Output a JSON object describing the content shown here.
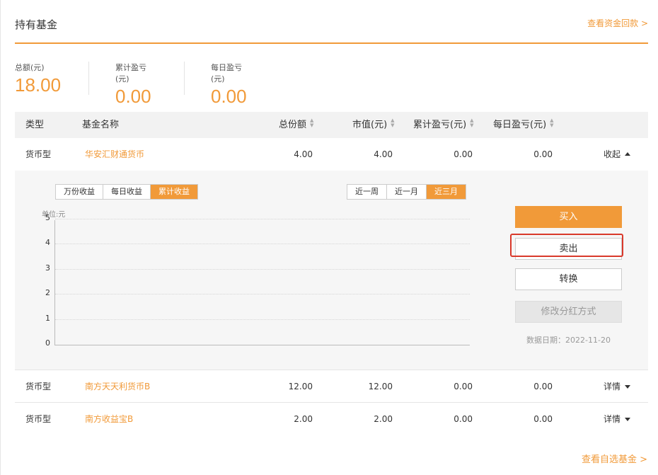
{
  "header": {
    "title": "持有基金",
    "link": "查看资金回款 >"
  },
  "summary": [
    {
      "label": "总额(元)",
      "value": "18.00"
    },
    {
      "label": "累计盈亏(元)",
      "value": "0.00"
    },
    {
      "label": "每日盈亏(元)",
      "value": "0.00"
    }
  ],
  "table": {
    "columns": [
      "类型",
      "基金名称",
      "总份额",
      "市值(元)",
      "累计盈亏(元)",
      "每日盈亏(元)"
    ],
    "rows": [
      {
        "type": "货币型",
        "name": "华安汇财通货币",
        "shares": "4.00",
        "market_value": "4.00",
        "cum_pl": "0.00",
        "daily_pl": "0.00",
        "action": "收起",
        "expanded": true
      },
      {
        "type": "货币型",
        "name": "南方天天利货币B",
        "shares": "12.00",
        "market_value": "12.00",
        "cum_pl": "0.00",
        "daily_pl": "0.00",
        "action": "详情",
        "expanded": false
      },
      {
        "type": "货币型",
        "name": "南方收益宝B",
        "shares": "2.00",
        "market_value": "2.00",
        "cum_pl": "0.00",
        "daily_pl": "0.00",
        "action": "详情",
        "expanded": false
      }
    ]
  },
  "detail": {
    "metric_tabs": [
      {
        "label": "万份收益",
        "active": false
      },
      {
        "label": "每日收益",
        "active": false
      },
      {
        "label": "累计收益",
        "active": true
      }
    ],
    "period_tabs": [
      {
        "label": "近一周",
        "active": false
      },
      {
        "label": "近一月",
        "active": false
      },
      {
        "label": "近三月",
        "active": true
      }
    ],
    "chart": {
      "unit_label": "单位:元",
      "y_ticks": [
        "5",
        "4",
        "3",
        "2",
        "1",
        "0"
      ]
    },
    "buttons": {
      "buy": "买入",
      "sell": "卖出",
      "convert": "转换",
      "modify_dividend": "修改分红方式"
    },
    "data_date": "数据日期：2022-11-20"
  },
  "chart_data": {
    "type": "line",
    "title": "",
    "xlabel": "",
    "ylabel": "单位:元",
    "ylim": [
      0,
      5
    ],
    "y_ticks": [
      0,
      1,
      2,
      3,
      4,
      5
    ],
    "series": [],
    "grid": true
  },
  "footer": {
    "link": "查看自选基金 >"
  },
  "colors": {
    "accent": "#f19a39",
    "highlight": "#d9392b"
  }
}
